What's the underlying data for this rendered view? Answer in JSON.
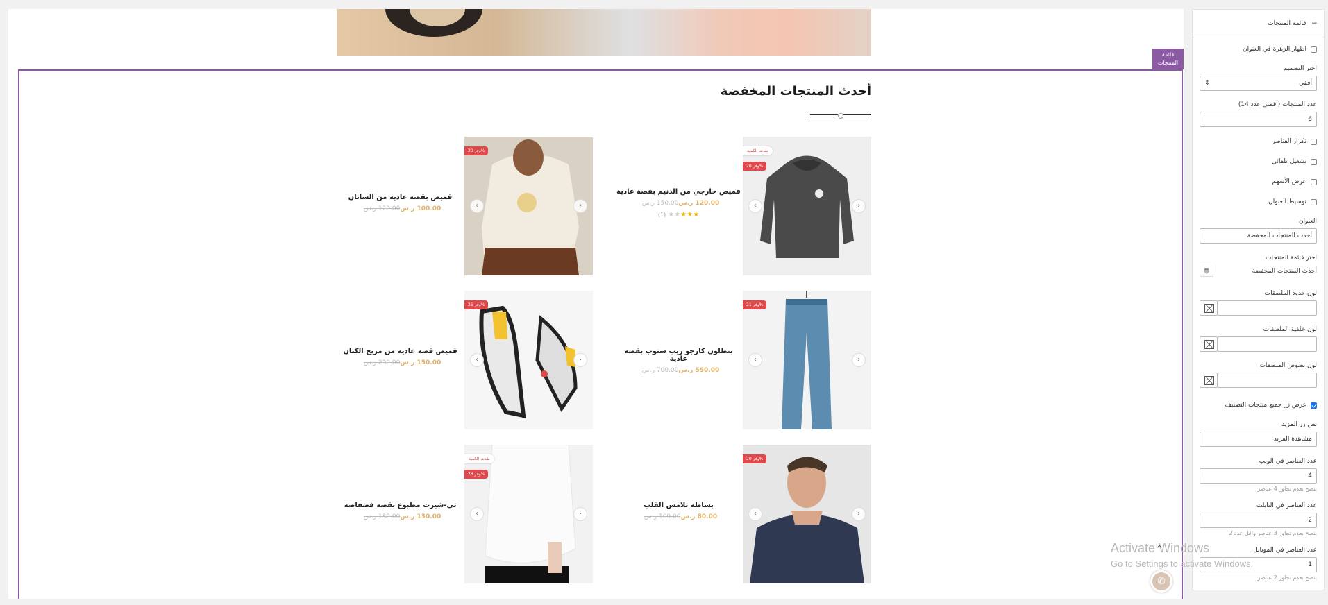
{
  "section_tag": "قائمة المنتجات",
  "section_title": "أحدث المنتجات المخفضة",
  "products": [
    {
      "name": "قميص خارجي من الدنيم بقصة عادية",
      "price": "120.00 ر.س",
      "old_price": "150.00 ر.س",
      "badge_sale": "وفر 20%",
      "badge_qty": "نفدت الكمية",
      "rating_filled": 3,
      "rating_total": 5,
      "rating_count": "(1)",
      "image": "hoodie-icon"
    },
    {
      "name": "قميص بقصة عادية من الساتان",
      "price": "100.00 ر.س",
      "old_price": "120.00 ر.س",
      "badge_sale": "وفر 20%",
      "badge_qty": "",
      "image": "sweater-icon"
    },
    {
      "name": "بنطلون كارجو ريب ستوب بقصة عادية",
      "price": "550.00 ر.س",
      "old_price": "700.00 ر.س",
      "badge_sale": "وفر 21%",
      "badge_qty": "",
      "image": "jeans-icon"
    },
    {
      "name": "قميص قصة عادية من مزيج الكتان",
      "price": "150.00 ر.س",
      "old_price": "200.00 ر.س",
      "badge_sale": "وفر 25%",
      "badge_qty": "",
      "image": "sneakers-icon"
    },
    {
      "name": "بساطة تلامس القلب",
      "price": "80.00 ر.س",
      "old_price": "100.00 ر.س",
      "badge_sale": "وفر 20%",
      "badge_qty": "",
      "image": "model-sweater-icon"
    },
    {
      "name": "تي-شيرت مطبوع بقصة فضفاضة",
      "price": "130.00 ر.س",
      "old_price": "180.00 ر.س",
      "badge_sale": "وفر 28%",
      "badge_qty": "نفدت الكمية",
      "image": "white-shirt-icon"
    }
  ],
  "panel": {
    "back_label": "قائمة المنتجات",
    "show_flower_label": "اظهار الزهرة في العنوان",
    "design_label": "اختر التصميم",
    "design_value": "أفقي",
    "count_label": "عدد المنتجات (أقصى عدد 14)",
    "count_value": "6",
    "repeat_label": "تكرار العناصر",
    "autoplay_label": "تشغيل تلقائي",
    "arrows_label": "عرض الأسهم",
    "center_title_label": "توسيط العنوان",
    "title_label": "العنوان",
    "title_value": "أحدث المنتجات المخفضة",
    "choose_list_label": "اختر قائمة المنتجات",
    "list_value": "أحدث المنتجات المخفضة",
    "tag_border_label": "لون حدود الملصقات",
    "tag_bg_label": "لون خلفية الملصقات",
    "tag_text_label": "لون نصوص الملصقات",
    "show_all_label": "عرض زر جميع منتجات التصنيف",
    "more_text_label": "نص زر المزيد",
    "more_text_value": "مشاهدة المزيد",
    "web_count_label": "عدد العناصر في الويب",
    "web_count_value": "4",
    "web_hint": "ينصح بعدم تجاوز 4 عناصر",
    "tablet_count_label": "عدد العناصر في التابلت",
    "tablet_count_value": "2",
    "tablet_hint": "ينصح بعدم تجاوز 3 عناصر واقل عدد 2",
    "mobile_count_label": "عدد العناصر في الموبايل",
    "mobile_count_value": "1",
    "mobile_hint": "ينصح بعدم تجاوز 2 عناصر"
  },
  "watermark": {
    "line1": "Activate Windows",
    "line2": "Go to Settings to activate Windows."
  },
  "colors": {
    "accent": "#8c5aa3",
    "sale": "#e1484b",
    "price": "#e0b36a"
  }
}
